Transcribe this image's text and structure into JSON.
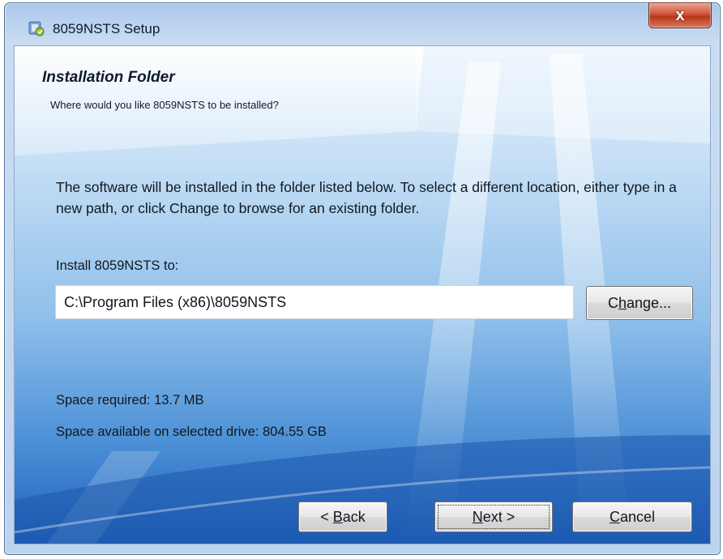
{
  "window": {
    "title": "8059NSTS Setup",
    "close_label": "x"
  },
  "header": {
    "title": "Installation Folder",
    "subtitle": "Where would you like 8059NSTS to be installed?"
  },
  "body": {
    "description": "The software will be installed in the folder listed below. To select a different location, either type in a new path, or click Change to browse for an existing folder.",
    "install_label": "Install 8059NSTS to:",
    "install_path": "C:\\Program Files (x86)\\8059NSTS",
    "change_button": {
      "prefix": "C",
      "accel": "h",
      "suffix": "ange..."
    },
    "space_required": "Space required: 13.7 MB",
    "space_available": "Space available on selected drive: 804.55 GB"
  },
  "buttons": {
    "back": {
      "prefix": "< ",
      "accel": "B",
      "suffix": "ack"
    },
    "next": {
      "prefix": "",
      "accel": "N",
      "suffix": "ext >"
    },
    "cancel": {
      "prefix": "",
      "accel": "C",
      "suffix": "ancel"
    }
  },
  "colors": {
    "accent": "#1e5fb8",
    "close": "#c8472b"
  }
}
